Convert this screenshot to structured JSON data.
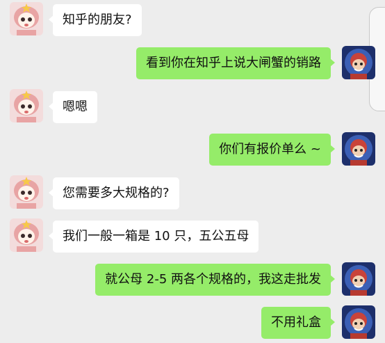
{
  "messages": [
    {
      "side": "in",
      "text": "知乎的朋友?"
    },
    {
      "side": "out",
      "text": "看到你在知乎上说大闸蟹的销路"
    },
    {
      "side": "in",
      "text": "嗯嗯"
    },
    {
      "side": "out",
      "text": "你们有报价单么 ~"
    },
    {
      "side": "in",
      "text": "您需要多大规格的?"
    },
    {
      "side": "in",
      "text": "我们一般一箱是 10 只，五公五母"
    },
    {
      "side": "out",
      "text": "就公母 2-5 两各个规格的，我这走批发"
    },
    {
      "side": "out",
      "text": "不用礼盒"
    }
  ],
  "colors": {
    "background": "#ededed",
    "incoming_bubble": "#ffffff",
    "outgoing_bubble": "#95ec69"
  },
  "icons": {
    "contact_avatar": "pink-haired-cartoon-girl-avatar",
    "user_avatar": "red-haired-character-avatar"
  }
}
